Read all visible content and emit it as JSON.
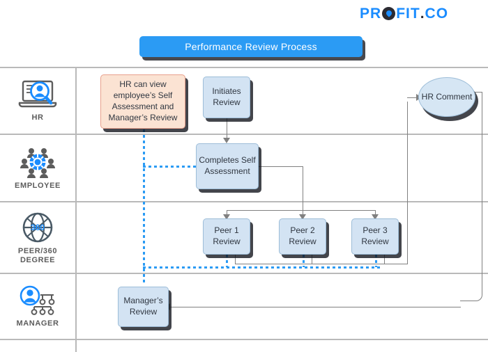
{
  "logo": {
    "part1": "PR",
    "o_icon": "droplet-o-icon",
    "part2": "FIT",
    "dot": ".",
    "part3": "CO"
  },
  "title": {
    "text": "Performance Review Process"
  },
  "lanes": [
    {
      "id": "hr",
      "label": "HR",
      "icon": "laptop-person-search-icon"
    },
    {
      "id": "employee",
      "label": "EMPLOYEE",
      "icon": "gear-people-icon"
    },
    {
      "id": "peer360",
      "label": "PEER/360 DEGREE",
      "icon": "globe-360-icon"
    },
    {
      "id": "manager",
      "label": "MANAGER",
      "icon": "person-org-chart-icon"
    }
  ],
  "nodes": [
    {
      "id": "hr-can-view",
      "lane": "hr",
      "label": "HR can view employee’s Self Assessment and Manager’s Review",
      "shape": "rect",
      "color": "peach"
    },
    {
      "id": "initiates-review",
      "lane": "hr",
      "label": "Initiates Review",
      "shape": "rect",
      "color": "blue"
    },
    {
      "id": "hr-comment",
      "lane": "hr",
      "label": "HR Comment",
      "shape": "ellipse",
      "color": "blue"
    },
    {
      "id": "completes-self-assessment",
      "lane": "employee",
      "label": "Completes Self Assessment",
      "shape": "rect",
      "color": "blue"
    },
    {
      "id": "peer-1-review",
      "lane": "peer360",
      "label": "Peer 1 Review",
      "shape": "rect",
      "color": "blue"
    },
    {
      "id": "peer-2-review",
      "lane": "peer360",
      "label": "Peer 2 Review",
      "shape": "rect",
      "color": "blue"
    },
    {
      "id": "peer-3-review",
      "lane": "peer360",
      "label": "Peer 3 Review",
      "shape": "rect",
      "color": "blue"
    },
    {
      "id": "managers-review",
      "lane": "manager",
      "label": "Manager’s Review",
      "shape": "rect",
      "color": "blue"
    }
  ],
  "colors": {
    "accent_blue": "#2b9bf4",
    "node_blue_fill": "#d3e3f3",
    "node_blue_border": "#9dbdd8",
    "node_peach_fill": "#fbe3d3",
    "node_peach_border": "#e8a08c",
    "connector_gray": "#808080",
    "divider_gray": "#b9b9b9",
    "text_dark": "#2f3640",
    "lane_label_gray": "#5c5c5c"
  }
}
